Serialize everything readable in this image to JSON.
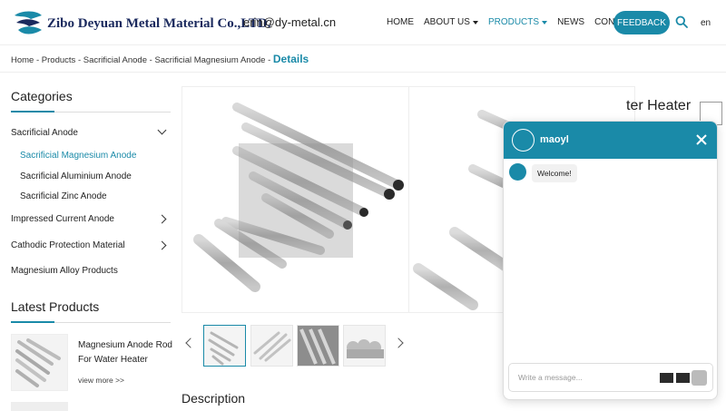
{
  "header": {
    "logo_text": "Zibo Deyuan Metal Material Co.,LTD.",
    "email": "erin@dy-metal.cn",
    "nav": [
      {
        "label": "HOME"
      },
      {
        "label": "ABOUT US"
      },
      {
        "label": "PRODUCTS"
      },
      {
        "label": "NEWS"
      },
      {
        "label": "CONTACT US"
      }
    ],
    "feedback_label": "FEEDBACK",
    "lang": "en",
    "icons": {
      "logo": "swirl-logo-icon",
      "search": "search-icon"
    }
  },
  "breadcrumb": {
    "items": [
      "Home",
      "Products",
      "Sacrificial Anode",
      "Sacrificial Magnesium Anode"
    ],
    "separator": "-",
    "current": "Details"
  },
  "sidebar": {
    "categories_title": "Categories",
    "categories": [
      {
        "label": "Sacrificial Anode",
        "expanded": true,
        "children": [
          "Sacrificial Magnesium Anode",
          "Sacrificial Aluminium Anode",
          "Sacrificial Zinc Anode"
        ]
      },
      {
        "label": "Impressed Current Anode"
      },
      {
        "label": "Cathodic Protection Material"
      },
      {
        "label": "Magnesium Alloy Products"
      }
    ],
    "latest_title": "Latest Products",
    "latest": [
      {
        "name": "Magnesium Anode Rod For Water Heater",
        "more": "view more >>"
      }
    ]
  },
  "product": {
    "title_visible": "ter Heater",
    "description_title": "Description"
  },
  "chat": {
    "name": "maoyl",
    "welcome": "Welcome!",
    "placeholder": "Write a message..."
  },
  "colors": {
    "accent": "#1a8aa8",
    "logo_navy": "#1b2a5e"
  }
}
